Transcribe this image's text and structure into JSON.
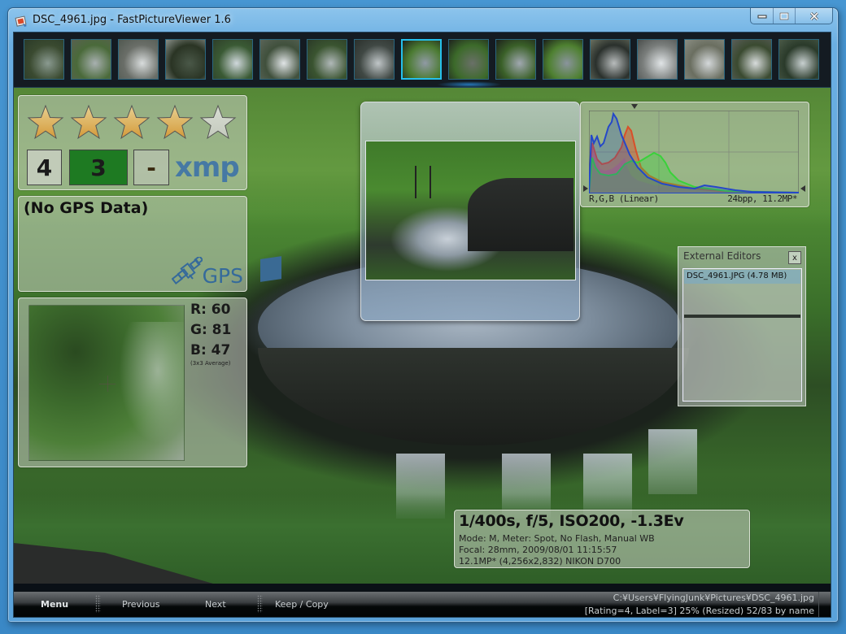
{
  "window": {
    "title": "DSC_4961.jpg - FastPictureViewer 1.6",
    "icon": "app-icon",
    "buttons": {
      "minimize": "minimize-icon",
      "maximize": "maximize-icon",
      "close": "close-icon"
    }
  },
  "thumbnails": {
    "count": 17,
    "active_index": 8,
    "items": [
      {
        "name": "waterfall-cliff"
      },
      {
        "name": "stream-rocks"
      },
      {
        "name": "rapids"
      },
      {
        "name": "forest-stream"
      },
      {
        "name": "waterfall-twin"
      },
      {
        "name": "waterfall-wide"
      },
      {
        "name": "waterfall-side"
      },
      {
        "name": "dam-spillway"
      },
      {
        "name": "round-weir-overview"
      },
      {
        "name": "round-weir-gate"
      },
      {
        "name": "round-weir-close"
      },
      {
        "name": "round-weir-far"
      },
      {
        "name": "weir-channel"
      },
      {
        "name": "spillway-curve"
      },
      {
        "name": "spillway-foam"
      },
      {
        "name": "dam-face"
      },
      {
        "name": "hidden"
      }
    ]
  },
  "rating": {
    "stars_total": 5,
    "stars_filled": 4,
    "rating_value": "4",
    "label_value": "3",
    "label_color": "#1e7a22",
    "reject_value": "-",
    "xmp_label": "xmp"
  },
  "gps": {
    "title": "(No GPS Data)",
    "logo_text": "GPS"
  },
  "color_picker": {
    "r_label": "R: 60",
    "g_label": "G: 81",
    "b_label": "B: 47",
    "note": "(3x3 Average)"
  },
  "histogram": {
    "mode_label": "R,G,B (Linear)",
    "info_label": "24bpp, 11.2MP*",
    "colors": {
      "red": "#d8502a",
      "green": "#39d23a",
      "blue": "#2548c8",
      "overlap_rg": "#c0a040",
      "magenta": "#c24a9a"
    }
  },
  "external_editors": {
    "title": "External Editors",
    "close_label": "x",
    "items": [
      "DSC_4961.JPG (4.78 MB)"
    ]
  },
  "exif": {
    "headline": "1/400s, f/5, ISO200, -1.3Ev",
    "line1": "Mode: M, Meter: Spot, No Flash, Manual WB",
    "line2": "Focal: 28mm, 2009/08/01 11:15:57",
    "line3": "12.1MP* (4,256x2,832) NIKON D700"
  },
  "bottombar": {
    "menu": "Menu",
    "previous": "Previous",
    "next": "Next",
    "keep_copy": "Keep / Copy",
    "path": "C:¥Users¥FlyingJunk¥Pictures¥DSC_4961.jpg",
    "status": "[Rating=4, Label=3] 25% (Resized) 52/83  by name"
  }
}
